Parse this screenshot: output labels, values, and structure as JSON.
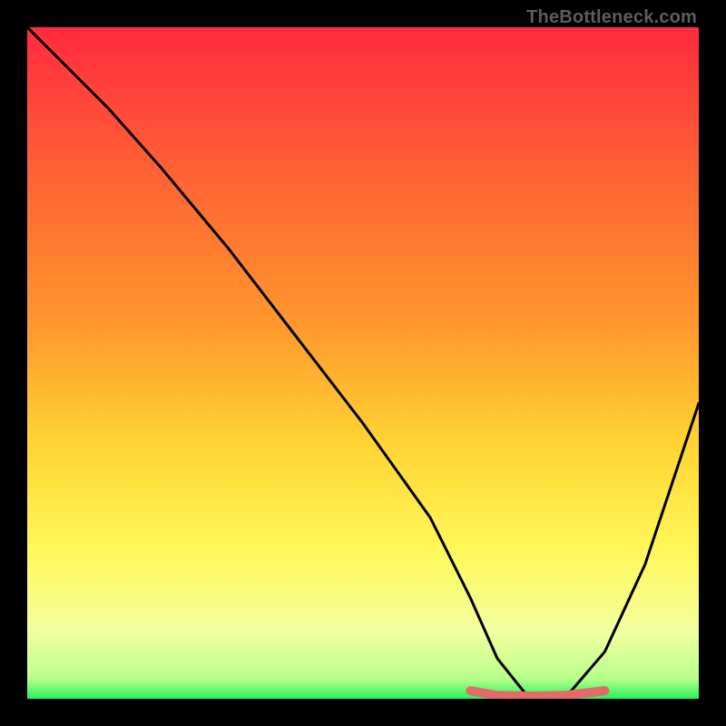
{
  "watermark": "TheBottleneck.com",
  "colors": {
    "background": "#000000",
    "gradient_top": "#ff2a3e",
    "gradient_mid1": "#ff8a2a",
    "gradient_mid2": "#ffe733",
    "gradient_mid3": "#f7ff7a",
    "gradient_bottom": "#25f25a",
    "curve": "#000000",
    "accent_curve": "#e46a6a"
  },
  "chart_data": {
    "type": "line",
    "title": "",
    "xlabel": "",
    "ylabel": "",
    "xlim": [
      0,
      100
    ],
    "ylim": [
      0,
      100
    ],
    "series": [
      {
        "name": "main-curve",
        "x": [
          0,
          4,
          8,
          12,
          20,
          30,
          40,
          50,
          60,
          66,
          70,
          74,
          76,
          80,
          86,
          92,
          100
        ],
        "y": [
          100,
          96,
          92,
          88,
          79,
          67,
          54,
          41,
          27,
          15,
          6,
          1,
          0,
          0,
          7,
          20,
          44
        ]
      },
      {
        "name": "accent-valley",
        "x": [
          66,
          70,
          74,
          76,
          80,
          86
        ],
        "y": [
          1.2,
          0.5,
          0.4,
          0.4,
          0.5,
          1.2
        ]
      }
    ],
    "notes": "Background is a vertical red→orange→yellow→green gradient inside a black frame. A thin black curve descends from top-left roughly linearly to a minimum near x≈76–80 (y≈0) then rises again toward the right edge reaching y≈44 at x=100. A short pink/red thick segment overlays the valley floor between x≈66 and x≈86."
  }
}
